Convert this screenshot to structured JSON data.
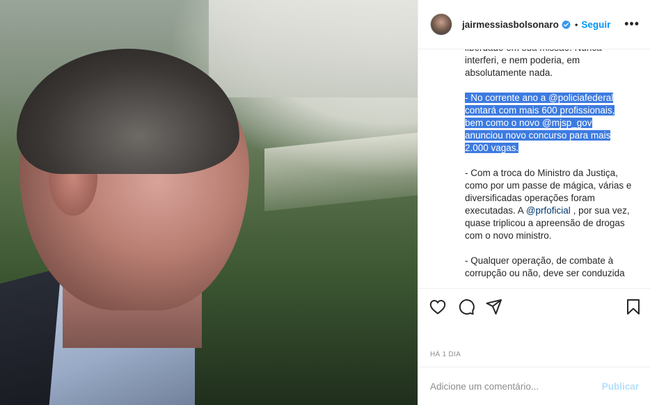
{
  "post": {
    "username": "jairmessiasbolsonaro",
    "follow_label": "Seguir",
    "dot": "•",
    "more_label": "•••",
    "time": "HÁ 1 DIA"
  },
  "caption": {
    "p1": "liberdade em sua missão. Nunca interferi, e nem poderia, em absolutamente nada.",
    "p2_highlighted": "- No corrente ano a @policiafederal contará com mais 600 profissionais, bem como o novo @mjsp_gov anunciou novo concurso para mais 2.000 vagas.",
    "p3_before": "- Com a troca do Ministro da Justiça, como por um passe de mágica, várias e diversificadas operações foram executadas. A ",
    "p3_mention": "@prfoficial",
    "p3_after": " , por sua vez, quase triplicou a apreensão de drogas com o novo ministro.",
    "p4": "- Qualquer operação, de combate à corrupção ou não, deve ser conduzida"
  },
  "comment": {
    "placeholder": "Adicione um comentário...",
    "publish_label": "Publicar"
  },
  "colors": {
    "accent": "#0095f6",
    "highlight": "#3d7be0",
    "publish_disabled": "#b2dffc"
  },
  "icons": [
    "verified-badge-icon",
    "heart-icon",
    "comment-icon",
    "share-icon",
    "bookmark-icon",
    "more-options-icon"
  ]
}
